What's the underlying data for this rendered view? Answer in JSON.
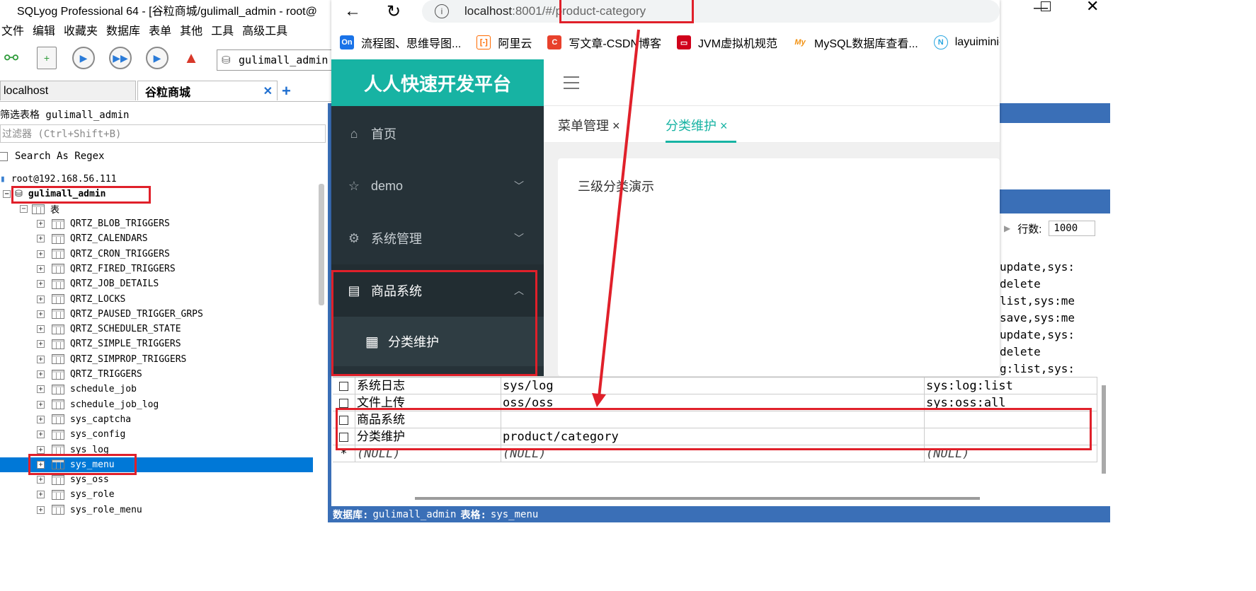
{
  "sqlyog": {
    "title": "SQLyog Professional 64 - [谷粒商城/gulimall_admin - root@",
    "menu": [
      "文件",
      "编辑",
      "收藏夹",
      "数据库",
      "表单",
      "其他",
      "工具",
      "高级工具"
    ],
    "db_combo": "gulimall_admin",
    "tabs": {
      "local": "localhost",
      "guli": "谷粒商城",
      "close": "✕",
      "add": "+"
    },
    "filter_label": "筛选表格 gulimall_admin",
    "filter_placeholder": "过滤器 (Ctrl+Shift+B)",
    "regex_label": "Search As Regex",
    "tree": {
      "root": "root@192.168.56.111",
      "db": "gulimall_admin",
      "tables_node": "表",
      "tables": [
        "QRTZ_BLOB_TRIGGERS",
        "QRTZ_CALENDARS",
        "QRTZ_CRON_TRIGGERS",
        "QRTZ_FIRED_TRIGGERS",
        "QRTZ_JOB_DETAILS",
        "QRTZ_LOCKS",
        "QRTZ_PAUSED_TRIGGER_GRPS",
        "QRTZ_SCHEDULER_STATE",
        "QRTZ_SIMPLE_TRIGGERS",
        "QRTZ_SIMPROP_TRIGGERS",
        "QRTZ_TRIGGERS",
        "schedule_job",
        "schedule_job_log",
        "sys_captcha",
        "sys_config",
        "sys_log",
        "sys_menu",
        "sys_oss",
        "sys_role",
        "sys_role_menu"
      ]
    },
    "row_count_label": "行数:",
    "row_count_value": "1000",
    "right_cells": [
      "update,sys:",
      "delete",
      "list,sys:me",
      "save,sys:me",
      "update,sys:",
      "delete",
      "g:list,sys:"
    ],
    "grid": [
      {
        "c1": "系统日志",
        "c2": "sys/log",
        "c3": "sys:log:list"
      },
      {
        "c1": "文件上传",
        "c2": "oss/oss",
        "c3": "sys:oss:all"
      },
      {
        "c1": "商品系统",
        "c2": "",
        "c3": ""
      },
      {
        "c1": "分类维护",
        "c2": "product/category",
        "c3": ""
      },
      {
        "c1": "(NULL)",
        "c2": "(NULL)",
        "c3": "(NULL)"
      }
    ],
    "new_row_marker": "*",
    "status": {
      "db_label": "数据库:",
      "db": "gulimall_admin",
      "table_label": "表格:",
      "table": "sys_menu"
    }
  },
  "browser": {
    "url_host": "localhost",
    "url_port": ":8001/",
    "url_hash": "#",
    "url_path": "/product-category",
    "bookmarks": [
      {
        "icon": "On",
        "color": "#1a73e8",
        "label": "流程图、思维导图..."
      },
      {
        "icon": "[-]",
        "color": "#ff6a00",
        "label": "阿里云"
      },
      {
        "icon": "C",
        "color": "#e8412c",
        "label": "写文章-CSDN博客"
      },
      {
        "icon": "▭",
        "color": "#d0021b",
        "label": "JVM虚拟机规范"
      },
      {
        "icon": "My",
        "color": "#f29111",
        "label": "MySQL数据库查看..."
      },
      {
        "icon": "N",
        "color": "#29a6e0",
        "label": "layuimini-"
      }
    ]
  },
  "app": {
    "brand": "人人快速开发平台",
    "menu": [
      {
        "icon": "⌂",
        "label": "首页"
      },
      {
        "icon": "☆",
        "label": "demo",
        "chev": "﹀"
      },
      {
        "icon": "⚙",
        "label": "系统管理",
        "chev": "﹀"
      },
      {
        "icon": "▤",
        "label": "商品系统",
        "chev": "︿"
      }
    ],
    "submenu": {
      "icon": "▦",
      "label": "分类维护"
    },
    "tabs": [
      {
        "label": "菜单管理",
        "close": "×"
      },
      {
        "label": "分类维护",
        "close": "×"
      }
    ],
    "content_text": "三级分类演示"
  },
  "colors": {
    "brand": "#17b3a3",
    "sidebar": "#263238",
    "annotation": "#e0202a",
    "sqlyog_blue": "#3a6fb7"
  }
}
